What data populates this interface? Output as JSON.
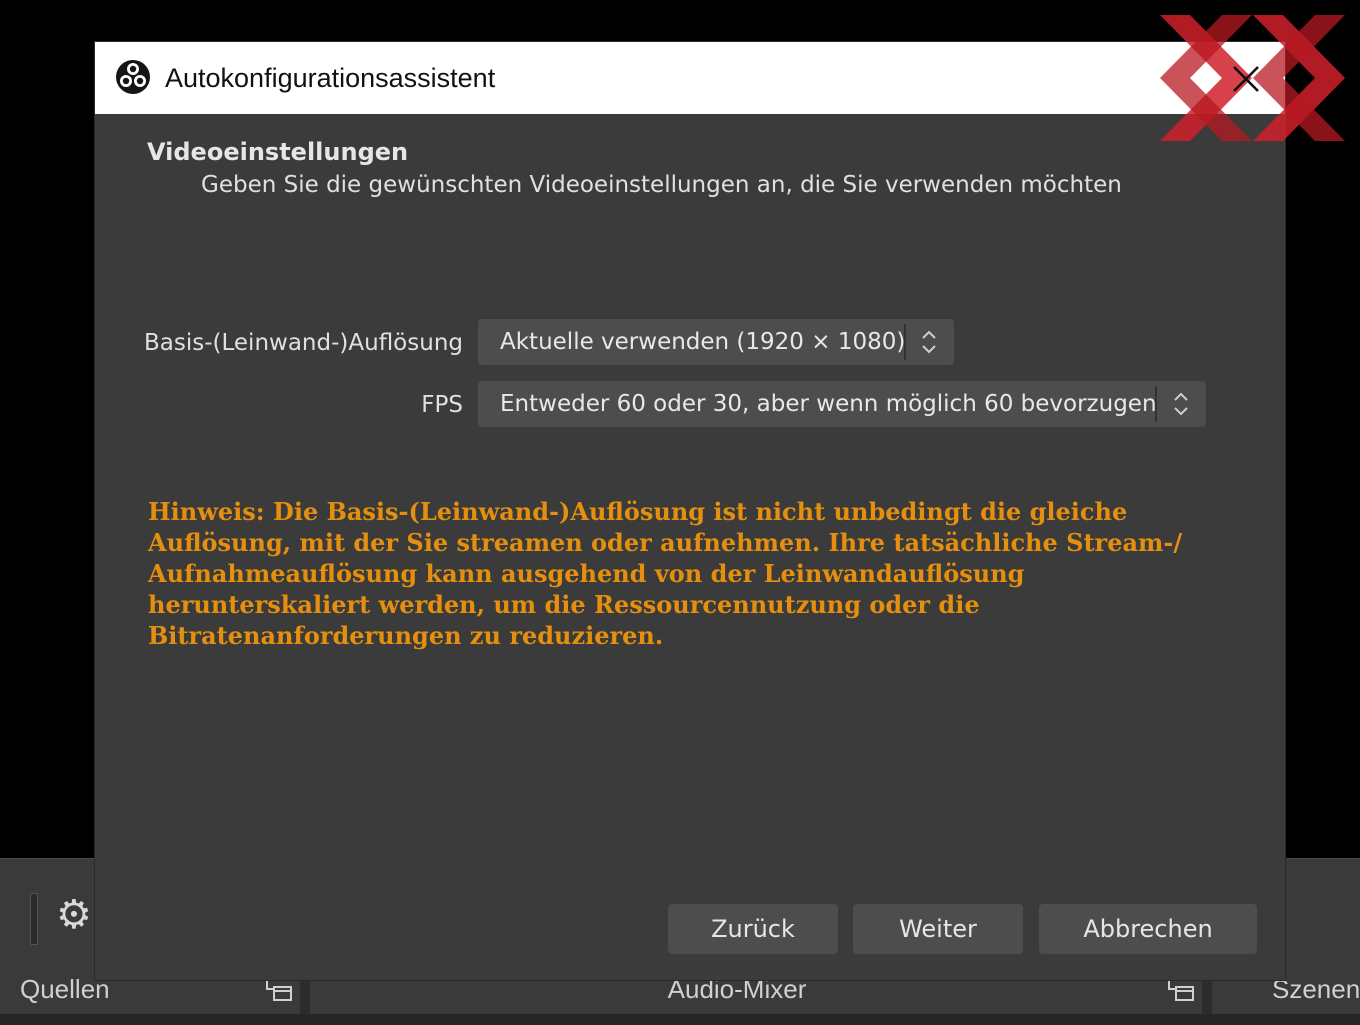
{
  "background": {
    "docks": {
      "sources_title": "Quellen",
      "mixer_title": "Audio-Mixer",
      "scenes_title": "Szenen"
    }
  },
  "dialog": {
    "title": "Autokonfigurationsassistent",
    "section_title": "Videoeinstellungen",
    "section_subtitle": "Geben Sie die gewünschten Videoeinstellungen an, die Sie verwenden möchten",
    "fields": {
      "resolution_label": "Basis-(Leinwand-)Auflösung",
      "resolution_value": "Aktuelle verwenden (1920 × 1080)",
      "fps_label": "FPS",
      "fps_value": "Entweder 60 oder 30, aber wenn möglich 60 bevorzugen"
    },
    "hint_lines": [
      "Hinweis: Die Basis-(Leinwand-)Auflösung ist nicht unbedingt die gleiche",
      "Auflösung, mit der Sie streamen oder aufnehmen. Ihre tatsächliche Stream-/",
      "Aufnahmeauflösung kann ausgehend von der Leinwandauflösung",
      "herunterskaliert werden, um die Ressourcennutzung oder die",
      "Bitratenanforderungen zu reduzieren."
    ],
    "buttons": {
      "back": "Zurück",
      "next": "Weiter",
      "cancel": "Abbrechen"
    }
  },
  "icons": {
    "app": "obs-logo-icon",
    "close": "close-icon",
    "settings": "gear-icon",
    "dock_float": "dock-float-icon",
    "combo_arrows": "updown-arrows-icon"
  },
  "colors": {
    "dialog_bg": "#3b3b3b",
    "titlebar_bg": "#ffffff",
    "hint_text": "#e58f0e",
    "control_bg": "#4d4d4d",
    "watermark": "#d0202a"
  }
}
